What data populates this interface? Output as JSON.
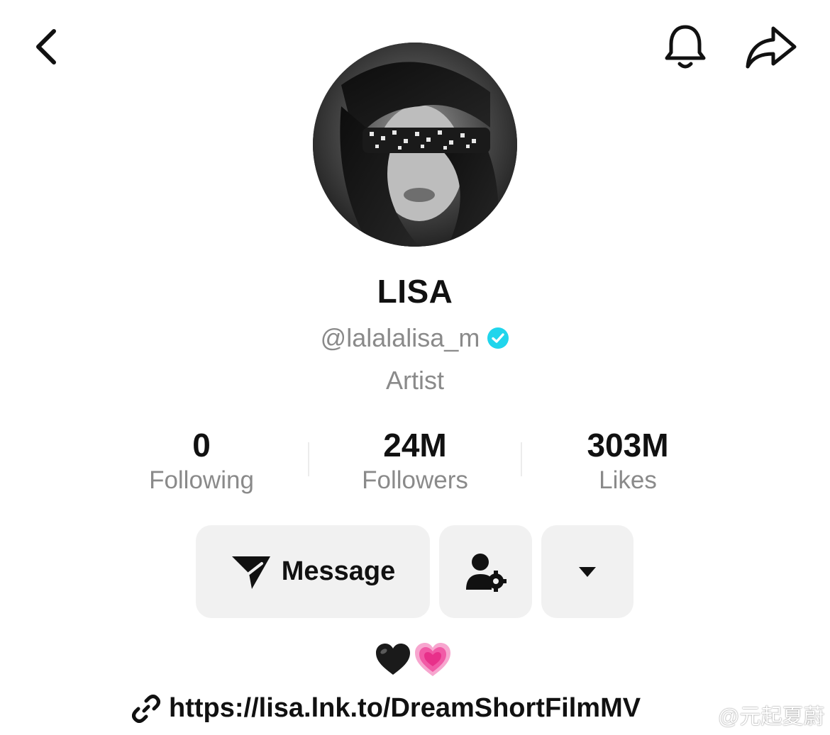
{
  "header": {
    "back_icon": "chevron-left-icon",
    "bell_icon": "bell-icon",
    "share_icon": "share-arrow-icon"
  },
  "profile": {
    "display_name": "LISA",
    "handle": "@lalalalisa_m",
    "verified_color": "#20D5EC",
    "bio_title": "Artist"
  },
  "stats": [
    {
      "value": "0",
      "label": "Following"
    },
    {
      "value": "24M",
      "label": "Followers"
    },
    {
      "value": "303M",
      "label": "Likes"
    }
  ],
  "actions": {
    "message_label": "Message",
    "message_icon": "send-icon",
    "profile_settings_icon": "user-settings-icon",
    "more_icon": "caret-down-icon"
  },
  "bio": {
    "emoji": "🖤💗",
    "link": "https://lisa.lnk.to/DreamShortFilmMV",
    "link_icon": "link-icon"
  },
  "watermark": {
    "text": "@元起夏蔚",
    "icon": "weibo-icon"
  }
}
